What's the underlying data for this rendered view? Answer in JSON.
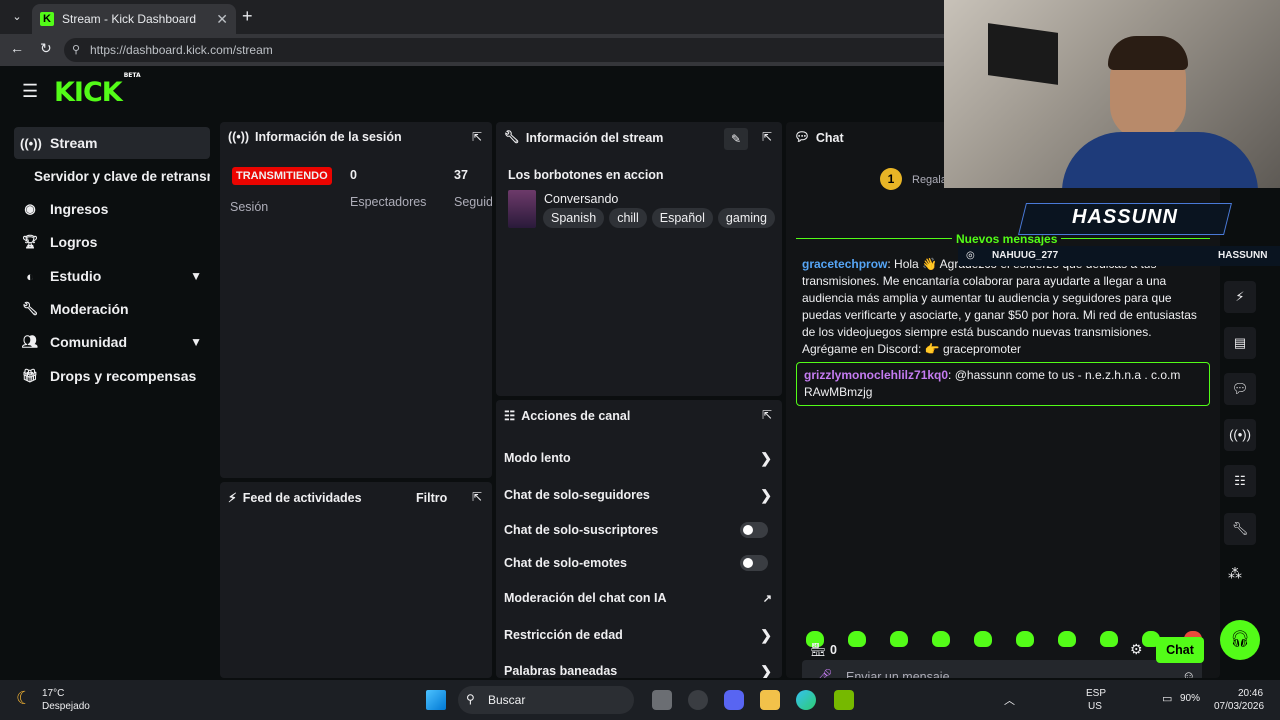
{
  "browser": {
    "tab_title": "Stream - Kick Dashboard",
    "url": "https://dashboard.kick.com/stream"
  },
  "app": {
    "logo": "KICK",
    "logo_badge": "BETA"
  },
  "sidebar": {
    "items": [
      {
        "label": "Stream",
        "icon": "broadcast-icon",
        "active": true
      },
      {
        "label": "Servidor y clave de retransm",
        "icon": "",
        "active": false
      },
      {
        "label": "Ingresos",
        "icon": "coins-icon"
      },
      {
        "label": "Logros",
        "icon": "trophy-icon"
      },
      {
        "label": "Estudio",
        "icon": "palette-icon",
        "expandable": true
      },
      {
        "label": "Moderación",
        "icon": "wrench-icon"
      },
      {
        "label": "Comunidad",
        "icon": "users-icon",
        "expandable": true
      },
      {
        "label": "Drops y recompensas",
        "icon": "gift-icon"
      }
    ]
  },
  "session": {
    "title": "Información de la sesión",
    "live_badge": "TRANSMITIENDO",
    "session_label": "Sesión",
    "viewers_value": "0",
    "viewers_label": "Espectadores",
    "followers_value": "37",
    "followers_label": "Seguid"
  },
  "stream_info": {
    "title": "Información del stream",
    "stream_title": "Los borbotones en accion",
    "category": "Conversando",
    "tags": [
      "Spanish",
      "chill",
      "Español",
      "gaming"
    ]
  },
  "activity": {
    "title": "Feed de actividades",
    "filter_label": "Filtro"
  },
  "channel_actions": {
    "title": "Acciones de canal",
    "items": [
      {
        "label": "Modo lento",
        "control": "arrow"
      },
      {
        "label": "Chat de solo-seguidores",
        "control": "arrow"
      },
      {
        "label": "Chat de solo-suscriptores",
        "control": "toggle"
      },
      {
        "label": "Chat de solo-emotes",
        "control": "toggle"
      },
      {
        "label": "Moderación del chat con IA",
        "control": "external"
      },
      {
        "label": "Restricción de edad",
        "control": "arrow"
      },
      {
        "label": "Palabras baneadas",
        "control": "arrow"
      }
    ]
  },
  "chat": {
    "title": "Chat",
    "gift_rank": "1",
    "gift_text": "Regala",
    "new_messages": "Nuevos mensajes",
    "messages": [
      {
        "user": "gracetechprow",
        "text": ": Hola 👋 Agradezco el esfuerzo que dedicas a tus transmisiones. Me encantaría colaborar para ayudarte a llegar a una audiencia más amplia y aumentar tu audiencia y seguidores para que puedas verificarte y asociarte, y ganar $50 por hora. Mi red de entusiastas de los videojuegos siempre está buscando nuevas transmisiones. Agrégame en Discord: 👉 gracepromoter",
        "user_color": "#56a5f5"
      },
      {
        "user": "grizzlymonoclehlilz71kq0",
        "text": ": @hassunn come to us - n.e.z.h.n.a . c.o.m RAwMBmzjg",
        "user_color": "#c57cf2",
        "highlighted": true
      }
    ],
    "input_placeholder": "Enviar un mensaje",
    "points": "0",
    "send_label": "Chat"
  },
  "overlay": {
    "name": "HASSUNN",
    "ig_handle": "NAHUUG_277",
    "kick_handle": "HASSUNN"
  },
  "taskbar": {
    "temp": "17°C",
    "weather": "Despejado",
    "search": "Buscar",
    "lang1": "ESP",
    "lang2": "US",
    "battery": "90%",
    "time": "20:46",
    "date": "07/03/2026"
  },
  "colors": {
    "accent": "#53fc18",
    "live": "#eb0400"
  }
}
